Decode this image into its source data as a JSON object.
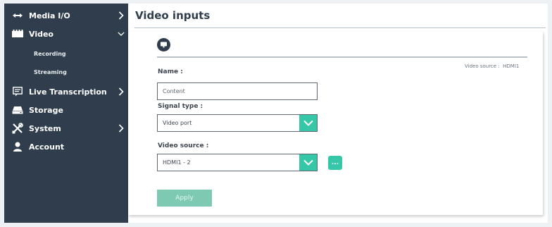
{
  "sidebar": {
    "items": [
      {
        "label": "Media I/O",
        "icon": "media-io-icon",
        "chevron": "right"
      },
      {
        "label": "Video",
        "icon": "video-icon",
        "chevron": "down"
      },
      {
        "label": "Recording"
      },
      {
        "label": "Streaming"
      },
      {
        "label": "Live Transcription",
        "icon": "live-transcription-icon",
        "chevron": "right"
      },
      {
        "label": "Storage",
        "icon": "storage-icon"
      },
      {
        "label": "System",
        "icon": "tools-icon",
        "chevron": "right"
      },
      {
        "label": "Account",
        "icon": "user-icon"
      }
    ]
  },
  "page": {
    "title": "Video inputs"
  },
  "card": {
    "badge_icon": "monitor-icon",
    "video_source_label": "Video source :",
    "video_source_value": "HDMI1"
  },
  "form": {
    "name_label": "Name :",
    "name_value": "Content",
    "signal_type_label": "Signal type :",
    "signal_type_value": "Video port",
    "video_source_label": "Video source :",
    "video_source_value": "HDMI1 - 2",
    "more_label": "...",
    "apply_label": "Apply"
  },
  "colors": {
    "sidebar_bg": "#2f3d4c",
    "accent": "#35c7a7",
    "apply_disabled": "#7dc9b2",
    "page_bg": "#eef1f4"
  }
}
